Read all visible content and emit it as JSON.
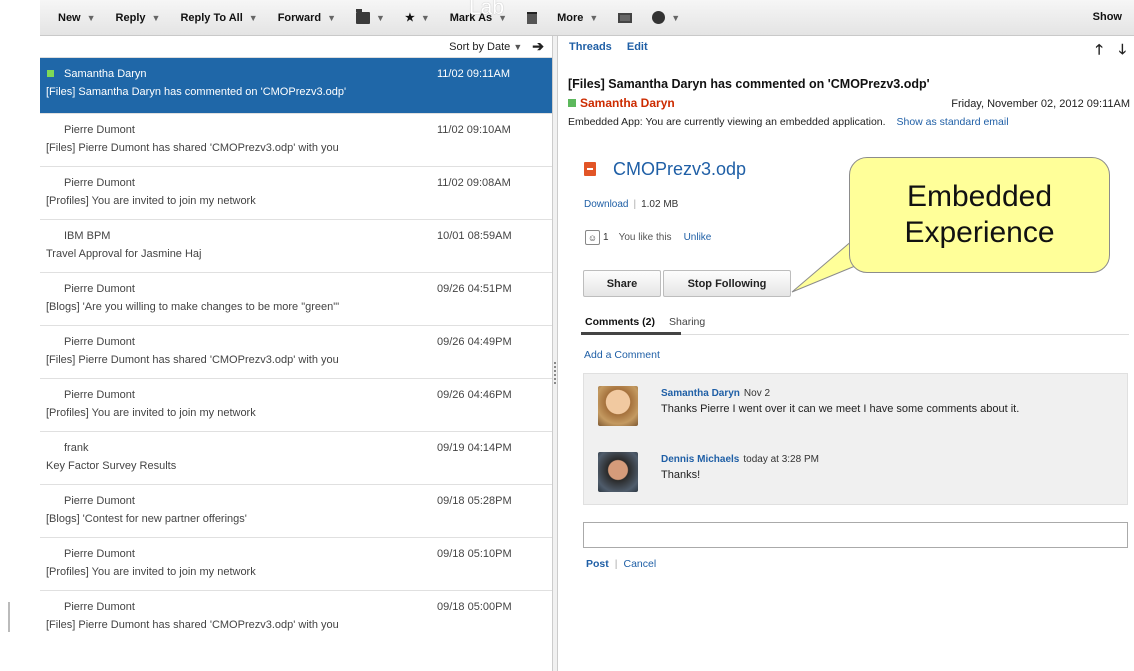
{
  "toolbar": {
    "new": "New",
    "reply": "Reply",
    "reply_all": "Reply To All",
    "forward": "Forward",
    "mark_as": "Mark As",
    "more": "More",
    "show": "Show",
    "overlay": "Lab"
  },
  "list": {
    "sort_label": "Sort by Date",
    "messages": [
      {
        "sender": "Samantha Daryn",
        "date": "11/02 09:11AM",
        "subject": "[Files] Samantha Daryn has commented on 'CMOPrezv3.odp'"
      },
      {
        "sender": "Pierre Dumont",
        "date": "11/02 09:10AM",
        "subject": "[Files] Pierre Dumont has shared 'CMOPrezv3.odp' with you"
      },
      {
        "sender": "Pierre Dumont",
        "date": "11/02 09:08AM",
        "subject": "[Profiles] You are invited to join my network"
      },
      {
        "sender": "IBM BPM",
        "date": "10/01 08:59AM",
        "subject": "Travel Approval for Jasmine Haj"
      },
      {
        "sender": "Pierre Dumont",
        "date": "09/26 04:51PM",
        "subject": "[Blogs] 'Are you willing to make changes to be more \"green\"'"
      },
      {
        "sender": "Pierre Dumont",
        "date": "09/26 04:49PM",
        "subject": "[Files] Pierre Dumont has shared 'CMOPrezv3.odp' with you"
      },
      {
        "sender": "Pierre Dumont",
        "date": "09/26 04:46PM",
        "subject": "[Profiles] You are invited to join my network"
      },
      {
        "sender": "frank",
        "date": "09/19 04:14PM",
        "subject": "Key Factor Survey Results"
      },
      {
        "sender": "Pierre Dumont",
        "date": "09/18 05:28PM",
        "subject": "[Blogs] 'Contest for new partner offerings'"
      },
      {
        "sender": "Pierre Dumont",
        "date": "09/18 05:10PM",
        "subject": "[Profiles] You are invited to join my network"
      },
      {
        "sender": "Pierre Dumont",
        "date": "09/18 05:00PM",
        "subject": "[Files] Pierre Dumont has shared 'CMOPrezv3.odp' with you"
      }
    ]
  },
  "reader": {
    "threads": "Threads",
    "edit": "Edit",
    "title": "[Files] Samantha Daryn has commented on 'CMOPrezv3.odp'",
    "from": "Samantha Daryn",
    "date": "Friday, November 02, 2012 09:11AM",
    "embedded_note": "Embedded App: You are currently viewing an embedded application.",
    "show_standard": "Show as standard email",
    "file_name": "CMOPrezv3.odp",
    "download": "Download",
    "file_size": "1.02 MB",
    "like_count": "1",
    "like_text": "You like this",
    "unlike": "Unlike",
    "share": "Share",
    "stop_following": "Stop Following",
    "tab_comments": "Comments (2)",
    "tab_sharing": "Sharing",
    "add_comment": "Add a Comment",
    "comments": [
      {
        "author": "Samantha Daryn",
        "when": "Nov 2",
        "text": "Thanks Pierre I went over it can we meet I have some comments about it."
      },
      {
        "author": "Dennis Michaels",
        "when": "today at 3:28 PM",
        "text": "Thanks!"
      }
    ],
    "post": "Post",
    "cancel": "Cancel"
  },
  "callout": {
    "line1": "Embedded",
    "line2": "Experience"
  },
  "colors": {
    "accent": "#1f5fa6",
    "selected_row": "#1f67a8",
    "sender_red": "#cc2b00",
    "callout_fill": "#ffff99"
  }
}
